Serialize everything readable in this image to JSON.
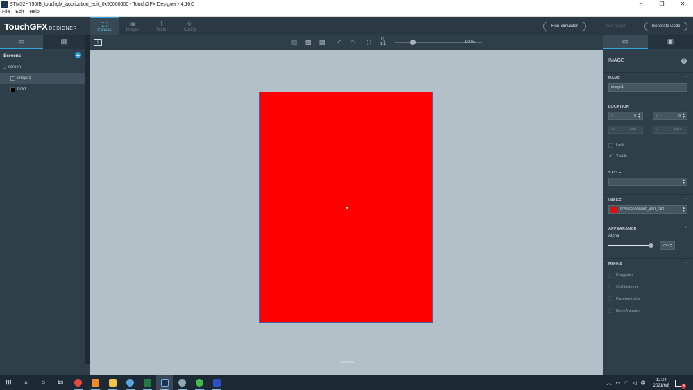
{
  "window": {
    "title": "STM32H750IB_touchgfx_application_edit_0x90000000 - TouchGFX Designer - 4.16.0",
    "minimize": "–",
    "maximize": "❐",
    "close": "✕"
  },
  "menu": [
    "File",
    "Edit",
    "Help"
  ],
  "header": {
    "logo": "TouchGFX",
    "logo_sub": "DESIGNER",
    "tabs": [
      {
        "label": "Canvas",
        "icon": "canvas-icon",
        "active": true
      },
      {
        "label": "Images",
        "icon": "images-icon",
        "active": false
      },
      {
        "label": "Texts",
        "icon": "texts-icon",
        "active": false
      },
      {
        "label": "Config",
        "icon": "config-icon",
        "active": false
      }
    ],
    "run_simulator": "Run Simulator",
    "run_target": "Run Target",
    "generate_code": "Generate Code"
  },
  "left_panel": {
    "screens_title": "Screens",
    "screen_name": "screen",
    "widgets": [
      {
        "name": "image1",
        "type": "image",
        "selected": true
      },
      {
        "name": "box1",
        "type": "box",
        "selected": false
      }
    ]
  },
  "toolbar": {
    "zoom": "100%",
    "zoom_level": 0.2,
    "fit_label": "1:1"
  },
  "properties": {
    "title": "IMAGE",
    "name_label": "NAME",
    "name_value": "image1",
    "location_label": "LOCATION",
    "x_label": "X",
    "x_value": "0",
    "y_label": "Y",
    "y_value": "0",
    "w_label": "W",
    "w_value": "480",
    "h_label": "H",
    "h_value": "640",
    "lock_label": "Lock",
    "visible_label": "Visible",
    "style_label": "STYLE",
    "style_value": "",
    "image_label": "IMAGE",
    "image_value": "R255G0008000_480_640....",
    "image_color": "#ff0000",
    "appearance_label": "APPEARANCE",
    "alpha_label": "Alpha",
    "alpha_value": "255",
    "mixins_label": "MIXINS",
    "mixins": [
      "Draggable",
      "ClickListener",
      "FadeAnimator",
      "MoveAnimator"
    ]
  },
  "canvas": {
    "background": "#b2c1c8",
    "artboard_color": "#ff0000"
  },
  "taskbar": {
    "time": "12:04",
    "date": "2021/6/8",
    "ime": "中",
    "notifications": "4"
  }
}
